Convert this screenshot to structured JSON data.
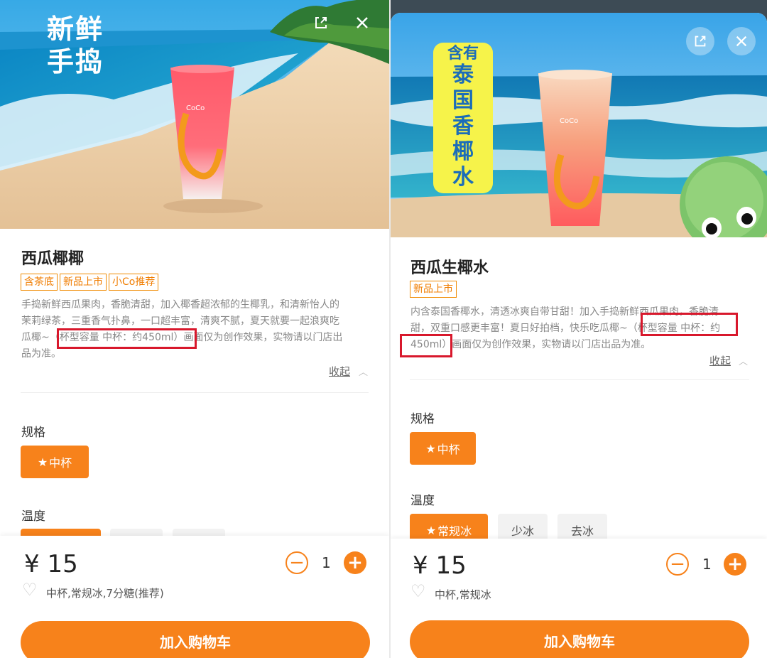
{
  "left": {
    "hero_title_line1": "新鲜",
    "hero_title_line2": "手捣",
    "cup_logo": "CoCo",
    "product_name": "西瓜椰椰",
    "tags": [
      "含茶底",
      "新品上市",
      "小Co推荐"
    ],
    "desc_line1": "手捣新鲜西瓜果肉，香脆清甜，加入椰香超浓郁的生椰乳，和清新怡人的",
    "desc_line2": "茉莉绿茶，三重香气扑鼻，一口超丰富，清爽不腻，夏天就要一起浪爽吃",
    "desc_line3a": "瓜椰~",
    "desc_line3b": "（杯型容量 中杯：约450ml）",
    "desc_line3c": "画面仅为创作效果，实物请以门店出",
    "desc_line4": "品为准。",
    "collapse_label": "收起",
    "spec_label": "规格",
    "spec_option": "中杯",
    "temp_label": "温度",
    "price": "¥ 15",
    "quantity": "1",
    "summary": "中杯,常规冰,7分糖(推荐)",
    "cart_button": "加入购物车"
  },
  "right": {
    "hero_title_line1": "含有",
    "hero_title_vertical": [
      "泰",
      "国",
      "香",
      "椰",
      "水"
    ],
    "cup_logo": "CoCo",
    "product_name": "西瓜生椰水",
    "tags": [
      "新品上市"
    ],
    "desc_line1": "内含泰国香椰水，清透冰爽自带甘甜！加入手捣新鲜西瓜果肉，香脆清",
    "desc_line2a": "甜，双重口感更丰富！夏日好拍档，快乐吃瓜椰~",
    "desc_line2b": "（杯型容量 中杯：约",
    "desc_line3a": "450ml）",
    "desc_line3b": "画面仅为创作效果，实物请以门店出品为准。",
    "collapse_label": "收起",
    "spec_label": "规格",
    "spec_option": "中杯",
    "temp_label": "温度",
    "temp_options": [
      "常规冰",
      "少冰",
      "去冰"
    ],
    "price": "¥ 15",
    "quantity": "1",
    "summary": "中杯,常规冰",
    "cart_button": "加入购物车"
  },
  "colors": {
    "accent": "#f7821b",
    "highlight_box": "#d8182c",
    "tag_border": "#f08a00"
  },
  "icons": {
    "share": "share-icon",
    "close": "close-icon",
    "star": "star-icon",
    "heart": "heart-icon"
  }
}
